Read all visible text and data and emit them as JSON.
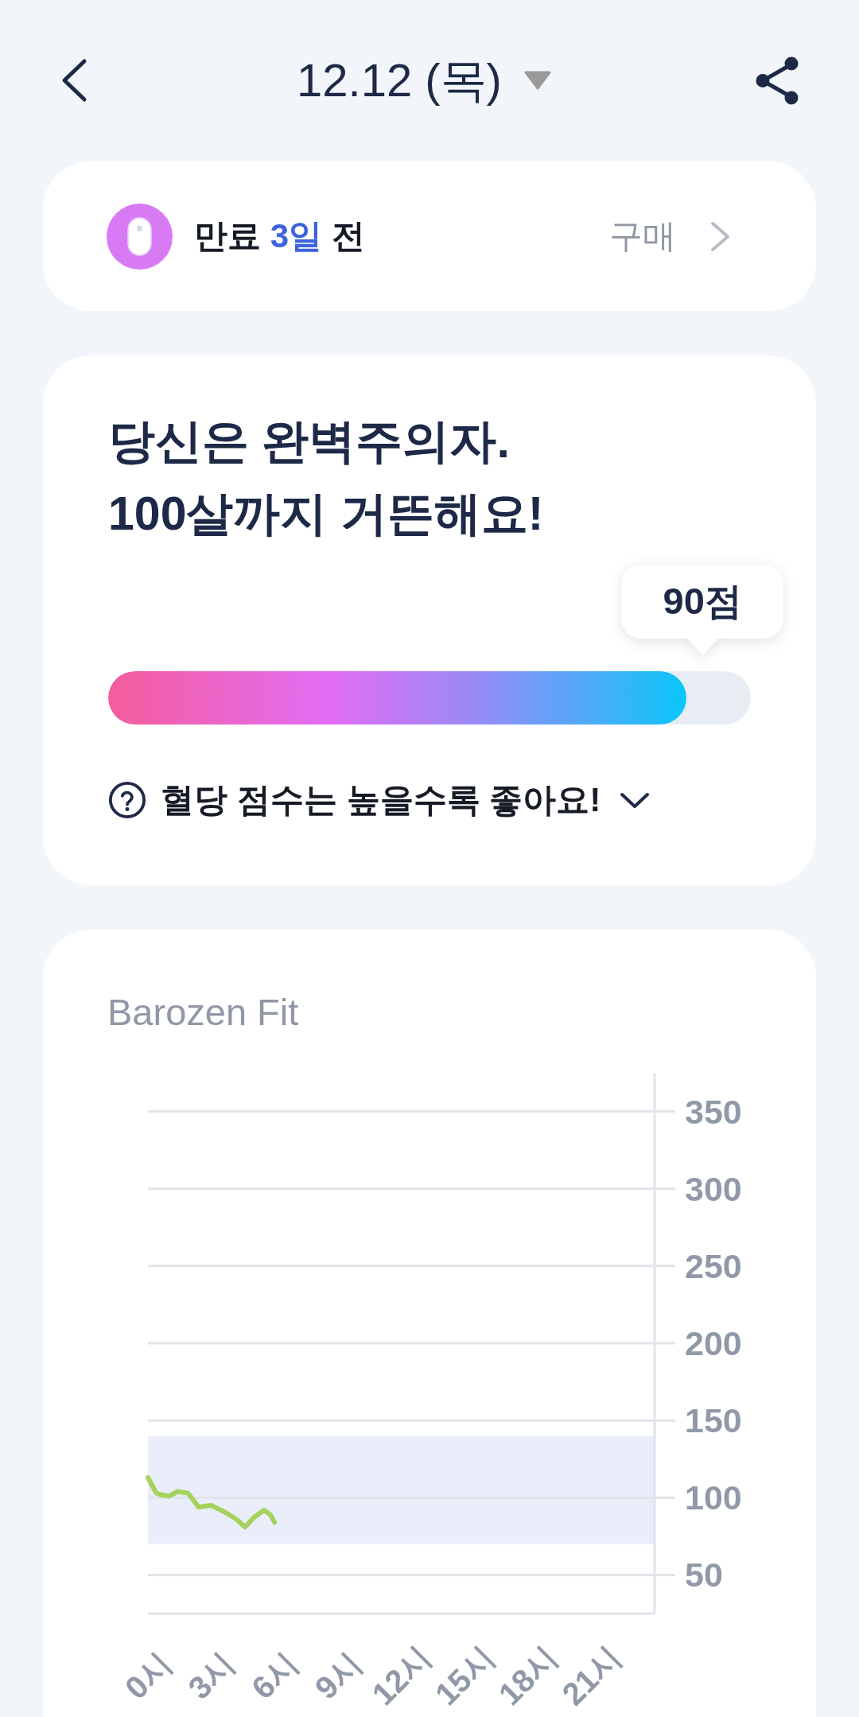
{
  "header": {
    "title": "12.12 (목)"
  },
  "subscription": {
    "label": "만료",
    "days": "3일",
    "suffix": "전",
    "action": "구매"
  },
  "score": {
    "headline": [
      "당신은 완벽주의자.",
      "100살까지 거뜬해요!"
    ],
    "label": "90점",
    "level": 0.9
  },
  "help": {
    "text": "혈당 점수는 높을수록 좋아요!",
    "expanded": false
  },
  "chart": {
    "chart_data": {
      "type": "line",
      "title": "Barozen Fit",
      "x": [
        0,
        0.4,
        0.6,
        1,
        1.4,
        1.9,
        2.4,
        3,
        3.6,
        4.2,
        4.6,
        5,
        5.5,
        5.8,
        6
      ],
      "series": [
        {
          "color": "#a5d25c",
          "values": [
            113,
            103,
            102,
            101,
            104,
            103,
            94,
            95,
            91,
            86,
            81,
            87,
            92,
            89,
            84
          ]
        }
      ],
      "xlim": [
        0,
        24
      ],
      "ylim": [
        25,
        375
      ],
      "xticks": [
        {
          "value": 0,
          "label": "0시"
        },
        {
          "value": 3,
          "label": "3시"
        },
        {
          "value": 6,
          "label": "6시"
        },
        {
          "value": 9,
          "label": "9시"
        },
        {
          "value": 12,
          "label": "12시"
        },
        {
          "value": 15,
          "label": "15시"
        },
        {
          "value": 18,
          "label": "18시"
        },
        {
          "value": 21,
          "label": "21시"
        }
      ],
      "yticks": [
        50,
        100,
        150,
        200,
        250,
        300,
        350
      ],
      "grid": true,
      "bands": [
        {
          "axis": "y",
          "from": 70,
          "to": 140
        }
      ]
    }
  }
}
